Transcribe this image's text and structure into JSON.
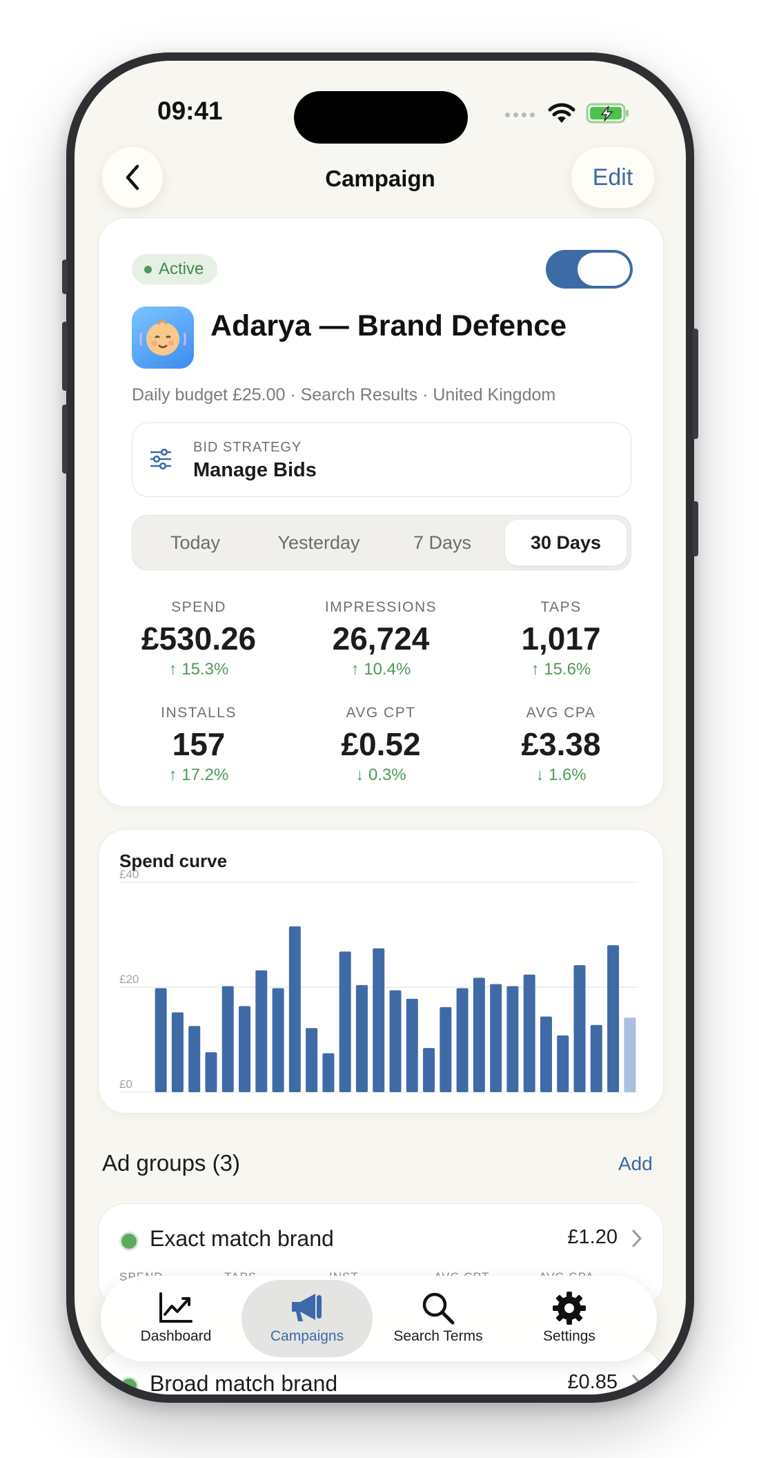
{
  "status_bar": {
    "time": "09:41"
  },
  "nav": {
    "title": "Campaign",
    "edit_label": "Edit"
  },
  "campaign": {
    "status": "Active",
    "enabled": true,
    "name": "Adarya — Brand Defence",
    "app_icon": "baby-face-icon",
    "subtitle": "Daily budget £25.00 · Search Results · United Kingdom",
    "bid_strategy_label": "BID STRATEGY",
    "bid_strategy_value": "Manage Bids"
  },
  "periods": {
    "items": [
      {
        "label": "Today",
        "active": false
      },
      {
        "label": "Yesterday",
        "active": false
      },
      {
        "label": "7 Days",
        "active": false
      },
      {
        "label": "30 Days",
        "active": true
      }
    ]
  },
  "metrics": [
    {
      "label": "SPEND",
      "value": "£530.26",
      "delta": "15.3%",
      "direction": "up"
    },
    {
      "label": "IMPRESSIONS",
      "value": "26,724",
      "delta": "10.4%",
      "direction": "up"
    },
    {
      "label": "TAPS",
      "value": "1,017",
      "delta": "15.6%",
      "direction": "up"
    },
    {
      "label": "INSTALLS",
      "value": "157",
      "delta": "17.2%",
      "direction": "up"
    },
    {
      "label": "AVG CPT",
      "value": "£0.52",
      "delta": "0.3%",
      "direction": "down"
    },
    {
      "label": "AVG CPA",
      "value": "£3.38",
      "delta": "1.6%",
      "direction": "down"
    }
  ],
  "chart": {
    "title": "Spend curve"
  },
  "chart_data": {
    "type": "bar",
    "title": "Spend curve",
    "ylim": [
      0,
      40
    ],
    "ytick_labels": [
      "£40",
      "£20",
      "£0"
    ],
    "yticks": [
      40,
      20,
      0
    ],
    "grid": true,
    "values": [
      19.8,
      15.2,
      12.6,
      7.6,
      20.2,
      16.4,
      23.2,
      19.8,
      31.6,
      12.2,
      7.4,
      26.8,
      20.4,
      27.4,
      19.4,
      17.8,
      8.4,
      16.2,
      19.8,
      21.8,
      20.6,
      20.2,
      22.4,
      14.4,
      10.8,
      24.2,
      12.8,
      28.0,
      14.2
    ],
    "bar_color": "#3f6aa6",
    "last_bar_color": "#a9c0dd"
  },
  "ad_groups": {
    "heading": "Ad groups (3)",
    "add_label": "Add",
    "columns": [
      "SPEND",
      "TAPS",
      "INST",
      "AVG CPT",
      "AVG CPA"
    ],
    "items": [
      {
        "name": "Exact match brand",
        "bid": "£1.20"
      },
      {
        "name": "Broad match brand",
        "bid": "£0.85"
      }
    ]
  },
  "tabbar": {
    "items": [
      {
        "label": "Dashboard",
        "icon": "chart-line-icon",
        "active": false
      },
      {
        "label": "Campaigns",
        "icon": "megaphone-icon",
        "active": true
      },
      {
        "label": "Search Terms",
        "icon": "search-icon",
        "active": false
      },
      {
        "label": "Settings",
        "icon": "gear-icon",
        "active": false
      }
    ]
  },
  "colors": {
    "accent": "#3a6aa8",
    "positive": "#4f9a56",
    "background": "#f8f6f0"
  }
}
